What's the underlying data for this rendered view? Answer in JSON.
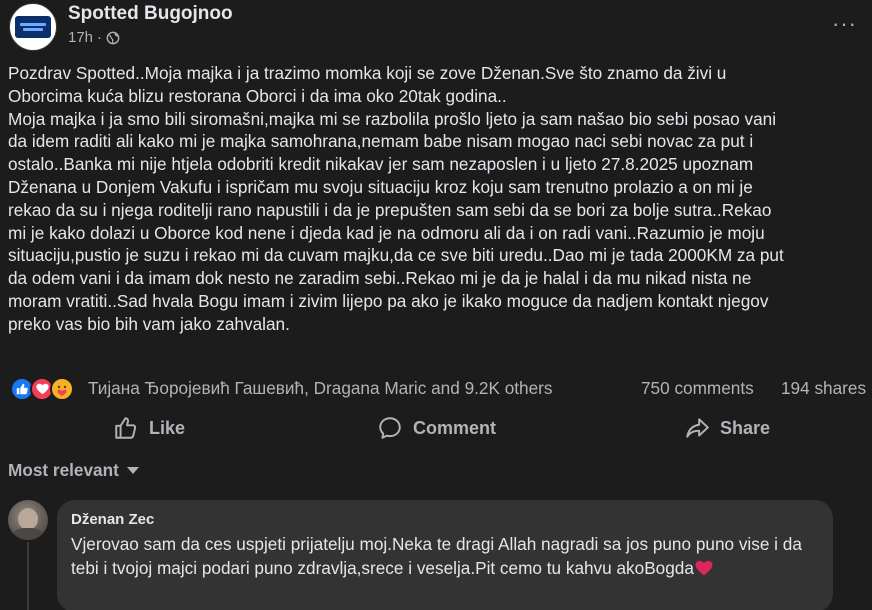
{
  "post": {
    "page_name": "Spotted Bugojnoo",
    "time": "17h",
    "separator": "·",
    "audience_icon": "globe-icon",
    "more_icon": "more-options-icon",
    "more_label": "···",
    "text": "Pozdrav Spotted..Moja majka i ja trazimo momka koji se zove Dženan.Sve što znamo da živi u\nOborcima kuća blizu restorana Oborci i da ima oko 20tak godina..\nMoja majka i ja smo bili siromašni,majka mi se razbolila prošlo ljeto ja sam našao bio sebi posao vani\nda idem raditi ali kako mi je majka samohrana,nemam babe nisam mogao naci sebi novac za put i\nostalo..Banka mi nije htjela odobriti kredit nikakav jer sam nezaposlen i u ljeto 27.8.2025 upoznam\nDženana u Donjem Vakufu i ispričam mu svoju situaciju kroz koju sam trenutno prolazio a on mi je\nrekao da su i njega roditelji rano napustili i da je prepušten sam sebi da se bori za bolje sutra..Rekao\nmi je kako dolazi u Oborce kod nene i djeda kad je na odmoru ali da i on radi vani..Razumio je moju\nsituaciju,pustio je suzu i rekao mi da cuvam majku,da ce sve biti uredu..Dao mi je tada 2000KM za put\nda odem vani i da imam dok nesto ne zaradim sebi..Rekao mi je da je halal i da mu nikad nista ne\nmoram vratiti..Sad hvala Bogu imam i zivim lijepo pa ako je ikako moguce da nadjem kontakt njegov\npreko vas bio bih vam jako zahvalan."
  },
  "reactions": {
    "types": [
      "like",
      "love",
      "care"
    ],
    "reactors_text": "Тијана Ђоројевић Гашевић, Dragana Maric and 9.2K others",
    "comments_text": "750 comments",
    "shares_text": "194 shares"
  },
  "actions": {
    "like_label": "Like",
    "comment_label": "Comment",
    "share_label": "Share"
  },
  "comments_section": {
    "sort_label": "Most relevant",
    "comments": [
      {
        "author": "Dženan Zec",
        "text": "Vjerovao sam da ces uspjeti prijatelju moj.Neka te dragi Allah nagradi sa jos puno puno vise i da tebi i tvojoj majci podari puno zdravlja,srece i veselja.Pit cemo tu kahvu akoBogda",
        "trailing_emoji": "heart-icon"
      }
    ]
  },
  "colors": {
    "background": "#1c1c1d",
    "text_primary": "#e4e6eb",
    "text_secondary": "#b0b3b8",
    "comment_bubble": "#333334",
    "like_blue": "#1877f2",
    "love_red": "#f33e58",
    "care_yellow": "#f7b125"
  }
}
